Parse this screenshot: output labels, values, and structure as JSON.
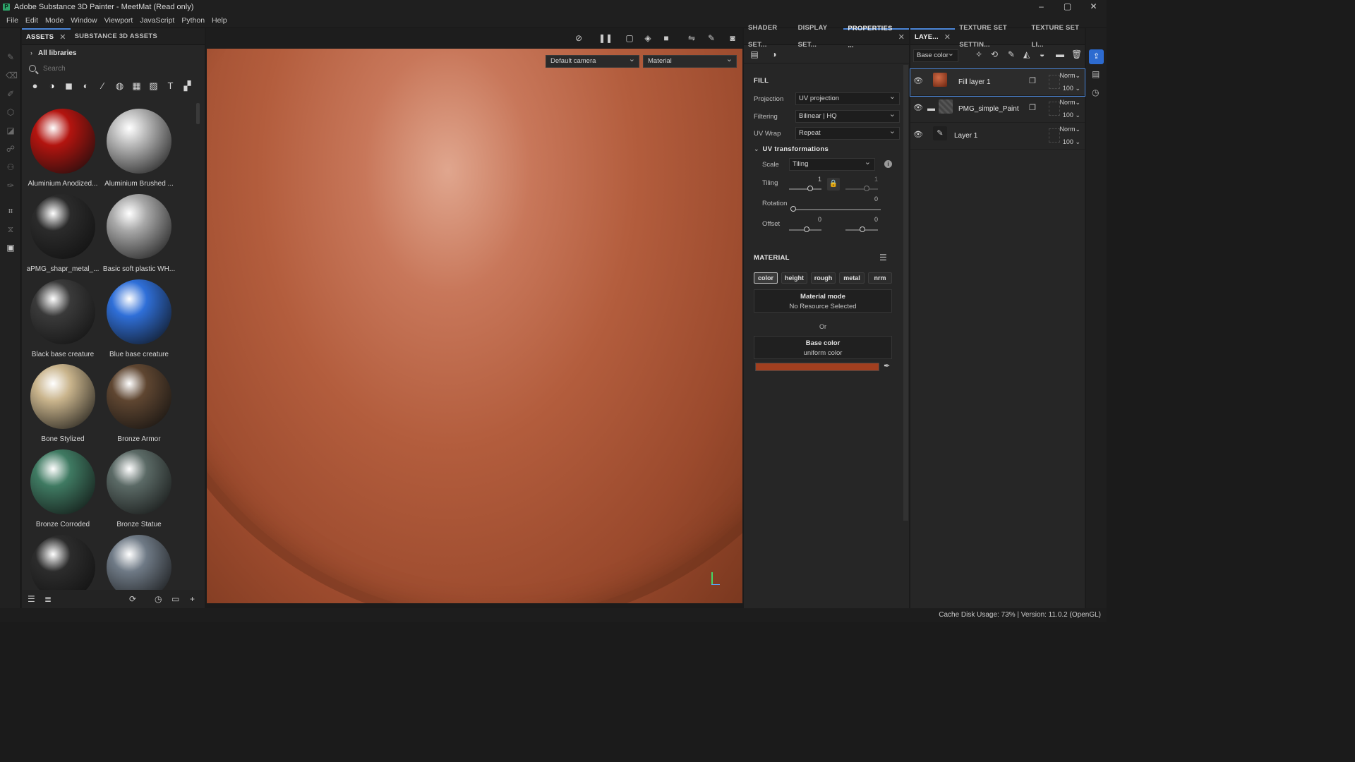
{
  "window": {
    "title": "Adobe Substance 3D Painter - MeetMat (Read only)",
    "app_icon_text": "P",
    "controls": [
      "–",
      "▢",
      "✕"
    ]
  },
  "menu": [
    "File",
    "Edit",
    "Mode",
    "Window",
    "Viewport",
    "JavaScript",
    "Python",
    "Help"
  ],
  "assets": {
    "tabs": [
      "ASSETS",
      "SUBSTANCE 3D ASSETS"
    ],
    "library": "All libraries",
    "search_placeholder": "Search",
    "items": [
      {
        "label": "Aluminium Anodized...",
        "color": "#b3140f"
      },
      {
        "label": "Aluminium Brushed ...",
        "color": "#b9b9b9"
      },
      {
        "label": "aPMG_shapr_metal_...",
        "color": "#2b2b2b"
      },
      {
        "label": "Basic soft plastic WH...",
        "color": "#a8a8a8"
      },
      {
        "label": "Black base creature",
        "color": "#3a3a3a"
      },
      {
        "label": "Blue base creature",
        "color": "#2f6fd8"
      },
      {
        "label": "Bone Stylized",
        "color": "#c9b48c"
      },
      {
        "label": "Bronze Armor",
        "color": "#5f4631"
      },
      {
        "label": "Bronze Corroded",
        "color": "#3f7a62"
      },
      {
        "label": "Bronze Statue",
        "color": "#5b6a66"
      },
      {
        "label": "",
        "color": "#2c2c2c"
      },
      {
        "label": "",
        "color": "#6f7a86"
      }
    ]
  },
  "viewport": {
    "camera": "Default camera",
    "mode": "Material"
  },
  "props": {
    "tabs": [
      "SHADER SET...",
      "DISPLAY SET...",
      "PROPERTIES ..."
    ],
    "fill_title": "FILL",
    "projection_label": "Projection",
    "projection_value": "UV projection",
    "filtering_label": "Filtering",
    "filtering_value": "Bilinear | HQ",
    "uvwrap_label": "UV Wrap",
    "uvwrap_value": "Repeat",
    "uv_transform_title": "UV transformations",
    "scale_label": "Scale",
    "scale_value": "Tiling",
    "tiling_label": "Tiling",
    "tiling_value_1": "1",
    "tiling_value_2": "1",
    "rotation_label": "Rotation",
    "rotation_value": "0",
    "offset_label": "Offset",
    "offset_value_1": "0",
    "offset_value_2": "0",
    "material_title": "MATERIAL",
    "channels": [
      "color",
      "height",
      "rough",
      "metal",
      "nrm"
    ],
    "material_mode_title": "Material mode",
    "material_mode_value": "No Resource Selected",
    "or_text": "Or",
    "base_color_title": "Base color",
    "base_color_value": "uniform color",
    "base_color_swatch": "#a23f1f"
  },
  "layers": {
    "tabs": [
      "LAYE...",
      "TEXTURE SET SETTIN...",
      "TEXTURE SET LI..."
    ],
    "channel_select": "Base color",
    "items": [
      {
        "name": "Fill layer 1",
        "blend": "Norm",
        "opacity": "100"
      },
      {
        "name": "PMG_simple_Paint",
        "blend": "Norm",
        "opacity": "100"
      },
      {
        "name": "Layer 1",
        "blend": "Norm",
        "opacity": "100"
      }
    ]
  },
  "status": "Cache Disk Usage:    73% | Version: 11.0.2 (OpenGL)"
}
